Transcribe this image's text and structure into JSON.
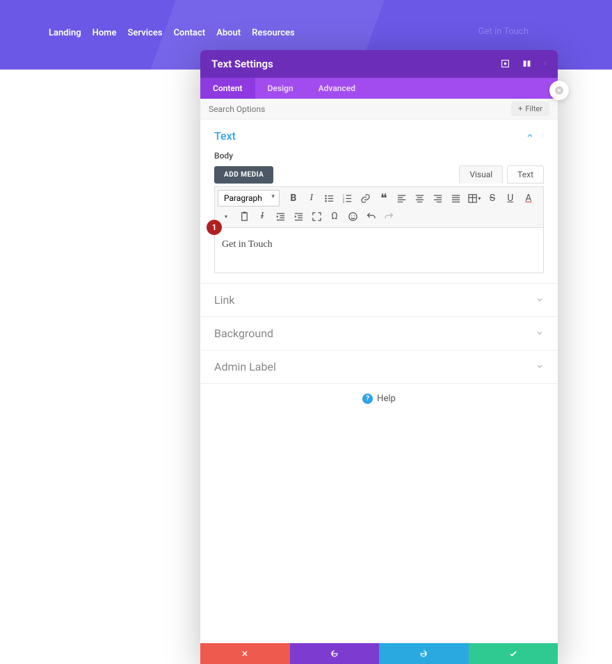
{
  "nav": {
    "items": [
      "Landing",
      "Home",
      "Services",
      "Contact",
      "About",
      "Resources"
    ],
    "ghost": "Get in Touch"
  },
  "modal": {
    "title": "Text Settings",
    "tabs": [
      "Content",
      "Design",
      "Advanced"
    ],
    "search_ph": "Search Options",
    "filter": "Filter",
    "sections": {
      "text": "Text",
      "body_label": "Body",
      "add_media": "ADD MEDIA",
      "visual": "Visual",
      "text_tab": "Text",
      "para": "Paragraph",
      "content": "Get in Touch",
      "link": "Link",
      "background": "Background",
      "admin": "Admin Label"
    },
    "help": "Help",
    "badge": "1"
  }
}
